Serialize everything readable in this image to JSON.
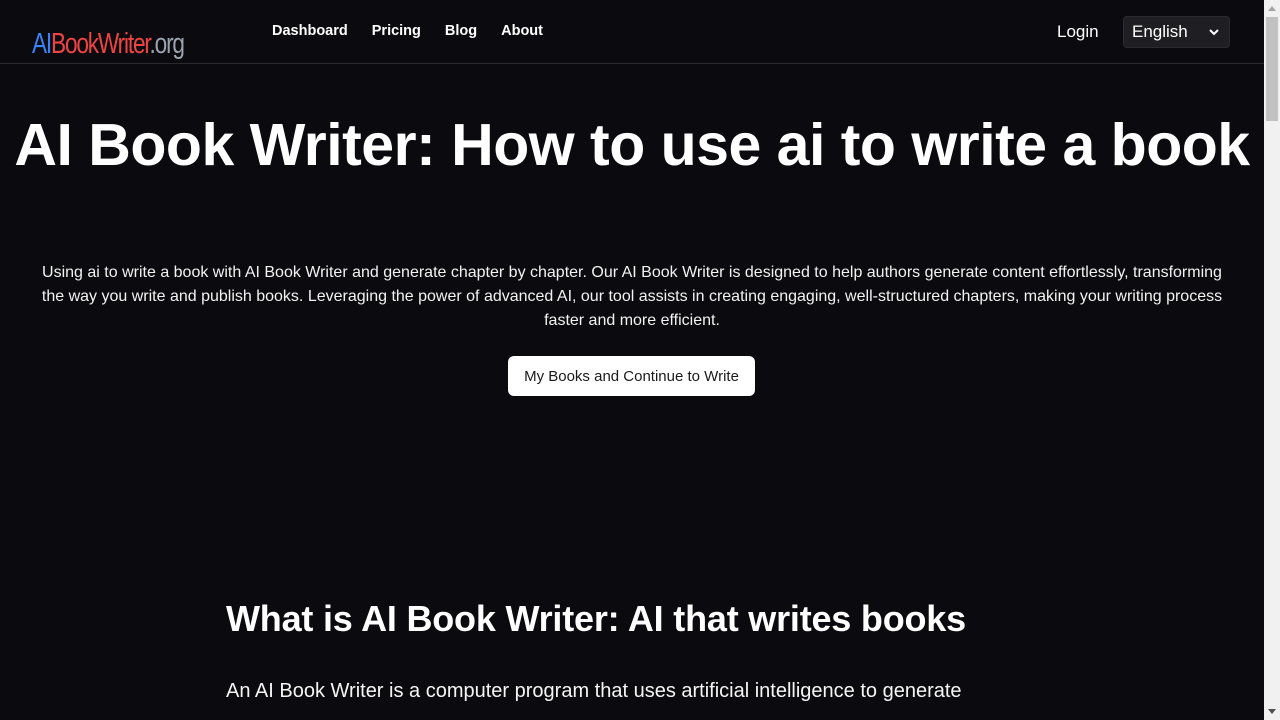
{
  "header": {
    "logo": {
      "ai": "AI",
      "book_writer": "BookWriter",
      "org": ".org"
    },
    "nav": [
      {
        "label": "Dashboard"
      },
      {
        "label": "Pricing"
      },
      {
        "label": "Blog"
      },
      {
        "label": "About"
      }
    ],
    "login_label": "Login",
    "language": {
      "selected": "English",
      "icon": "chevron-down-icon"
    }
  },
  "hero": {
    "title": "AI Book Writer: How to use ai to write a book",
    "description": "Using ai to write a book with AI Book Writer and generate chapter by chapter. Our AI Book Writer is designed to help authors generate content effortlessly, transforming the way you write and publish books. Leveraging the power of advanced AI, our tool assists in creating engaging, well-structured chapters, making your writing process faster and more efficient.",
    "cta_label": "My Books and Continue to Write"
  },
  "section": {
    "title": "What is AI Book Writer: AI that writes books",
    "body": "An AI Book Writer is a computer program that uses artificial intelligence to generate"
  },
  "colors": {
    "background": "#0b0b0f",
    "logo_ai": "#3b82f6",
    "logo_book_writer": "#ef4444",
    "logo_org": "#9ca3af",
    "cta_background": "#ffffff"
  }
}
